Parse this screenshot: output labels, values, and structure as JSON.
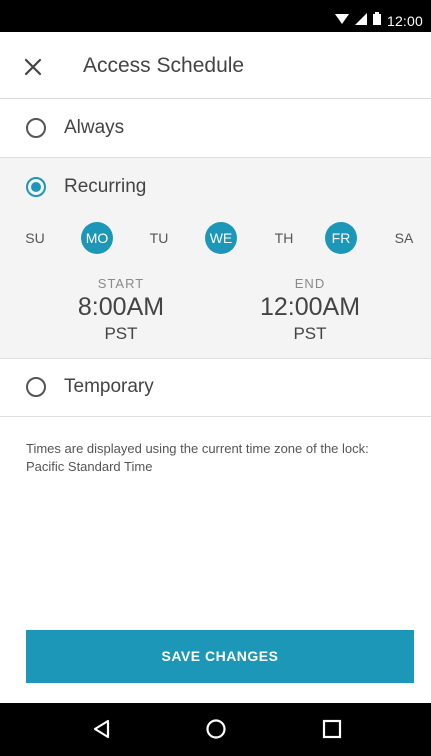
{
  "status_bar": {
    "time": "12:00"
  },
  "header": {
    "title": "Access Schedule",
    "close_icon": "close-icon"
  },
  "options": {
    "always": {
      "label": "Always",
      "checked": false
    },
    "recurring": {
      "label": "Recurring",
      "checked": true
    },
    "temporary": {
      "label": "Temporary",
      "checked": false
    }
  },
  "days": [
    {
      "label": "SU",
      "selected": false
    },
    {
      "label": "MO",
      "selected": true
    },
    {
      "label": "TU",
      "selected": false
    },
    {
      "label": "WE",
      "selected": true
    },
    {
      "label": "TH",
      "selected": false
    },
    {
      "label": "FR",
      "selected": true
    },
    {
      "label": "SA",
      "selected": false
    }
  ],
  "schedule": {
    "start": {
      "caption": "START",
      "time": "8:00AM",
      "tz": "PST"
    },
    "end": {
      "caption": "END",
      "time": "12:00AM",
      "tz": "PST"
    }
  },
  "note": "Times are displayed using the current time zone of the lock: Pacific Standard Time",
  "save_button": {
    "label": "SAVE CHANGES"
  },
  "colors": {
    "accent": "#1d97b8",
    "bar": "#000000",
    "recurring_bg": "#f4f4f4"
  },
  "nav": {
    "back_icon": "back-triangle-icon",
    "home_icon": "home-circle-icon",
    "recents_icon": "recents-square-icon"
  }
}
